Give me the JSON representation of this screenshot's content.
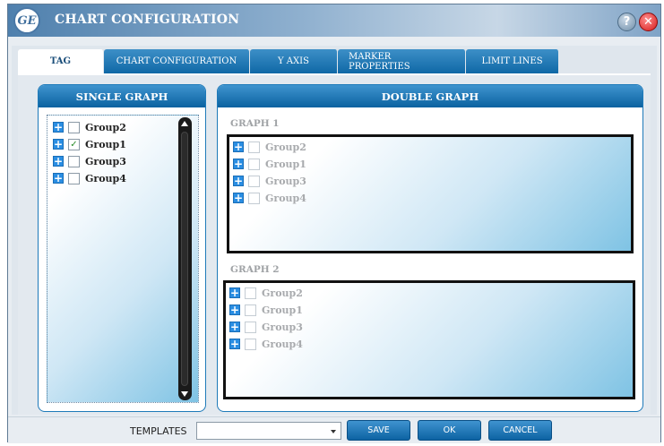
{
  "window": {
    "title": "CHART CONFIGURATION",
    "logo_text": "GE",
    "help_icon": "question-icon",
    "close_icon": "close-icon"
  },
  "tabs": [
    {
      "label": "TAG",
      "active": true
    },
    {
      "label": "CHART CONFIGURATION",
      "active": false
    },
    {
      "label": "Y AXIS",
      "active": false
    },
    {
      "label": "MARKER PROPERTIES",
      "active": false
    },
    {
      "label": "LIMIT LINES",
      "active": false
    }
  ],
  "single_graph": {
    "title": "SINGLE GRAPH",
    "items": [
      {
        "label": "Group2",
        "checked": false
      },
      {
        "label": "Group1",
        "checked": true
      },
      {
        "label": "Group3",
        "checked": false
      },
      {
        "label": "Group4",
        "checked": false
      }
    ]
  },
  "double_graph": {
    "title": "DOUBLE GRAPH",
    "graph1": {
      "label": "GRAPH 1",
      "items": [
        {
          "label": "Group2"
        },
        {
          "label": "Group1"
        },
        {
          "label": "Group3"
        },
        {
          "label": "Group4"
        }
      ]
    },
    "graph2": {
      "label": "GRAPH 2",
      "items": [
        {
          "label": "Group2"
        },
        {
          "label": "Group1"
        },
        {
          "label": "Group3"
        },
        {
          "label": "Group4"
        }
      ]
    }
  },
  "footer": {
    "templates_label": "TEMPLATES",
    "templates_value": "",
    "save_label": "SAVE",
    "ok_label": "OK",
    "cancel_label": "CANCEL"
  },
  "colors": {
    "accent": "#0f68a6",
    "plus": "#2a8ee3",
    "check": "#2c8d2c"
  }
}
